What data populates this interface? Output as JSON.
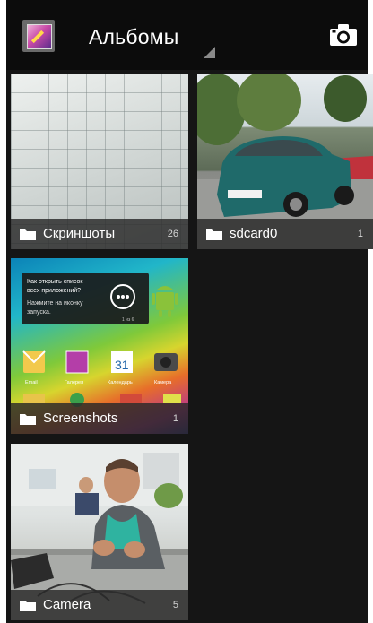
{
  "actionbar": {
    "title": "Альбомы",
    "app_icon": "gallery-icon",
    "camera_icon": "camera-icon"
  },
  "albums": [
    {
      "name": "Скриншоты",
      "count": "26",
      "thumbnail": "grid-photo"
    },
    {
      "name": "sdcard0",
      "count": "1",
      "thumbnail": "car-photo"
    },
    {
      "name": "Screenshots",
      "count": "1",
      "thumbnail": "homescreen-screenshot"
    },
    {
      "name": "Camera",
      "count": "5",
      "thumbnail": "office-photo"
    }
  ],
  "screenshot_tile": {
    "tooltip_line1": "Как открыть список",
    "tooltip_line2": "всех приложений?",
    "tooltip_line3": "Нажмите на иконку",
    "tooltip_line4": "запуска.",
    "tooltip_page": "1 из 6",
    "apps": [
      "Email",
      "Галерея",
      "Календарь",
      "Камера"
    ],
    "calendar_day": "31"
  },
  "colors": {
    "background": "#151515",
    "caption_bg": "#282828",
    "actionbar_bg": "#0c0c0c"
  }
}
